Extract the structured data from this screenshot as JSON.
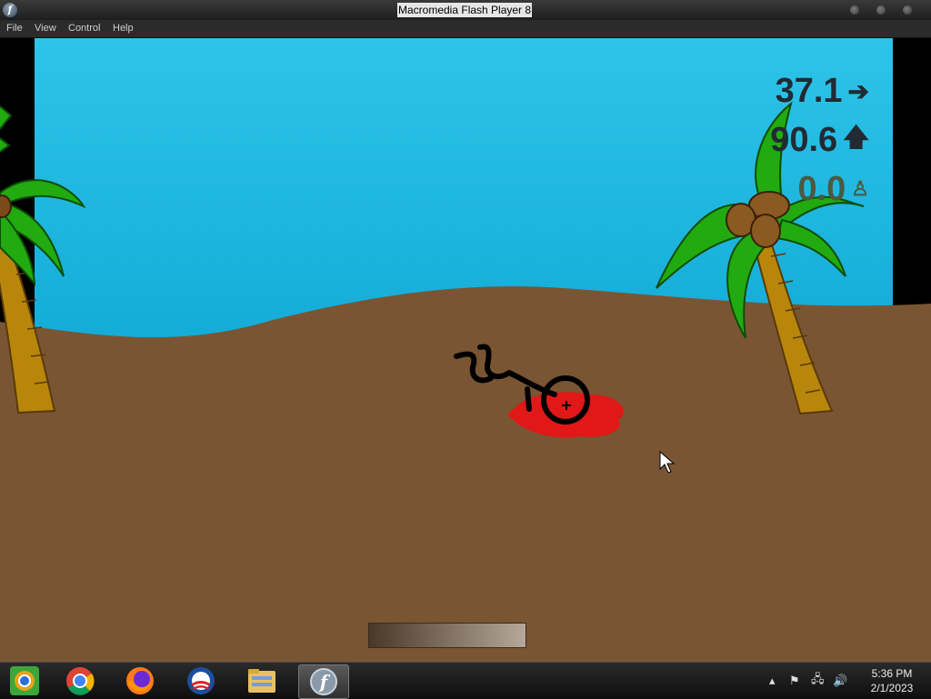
{
  "window": {
    "title": "Macromedia Flash Player 8"
  },
  "menu": {
    "items": [
      "File",
      "View",
      "Control",
      "Help"
    ]
  },
  "hud": {
    "distance": "37.1",
    "height": "90.6",
    "third": "0.0"
  },
  "taskbar": {
    "apps": [
      "chrome-launcher-icon",
      "chrome-icon",
      "firefox-icon",
      "obama-logo-icon",
      "file-explorer-icon",
      "flash-player-icon"
    ],
    "clock_time": "5:36 PM",
    "clock_date": "2/1/2023"
  },
  "colors": {
    "sky_top": "#29c8e6",
    "sky_bottom": "#17aedb",
    "sand": "#7a5533",
    "palm_leaf": "#22aa11",
    "trunk": "#b8860b",
    "blood": "#e01818"
  }
}
